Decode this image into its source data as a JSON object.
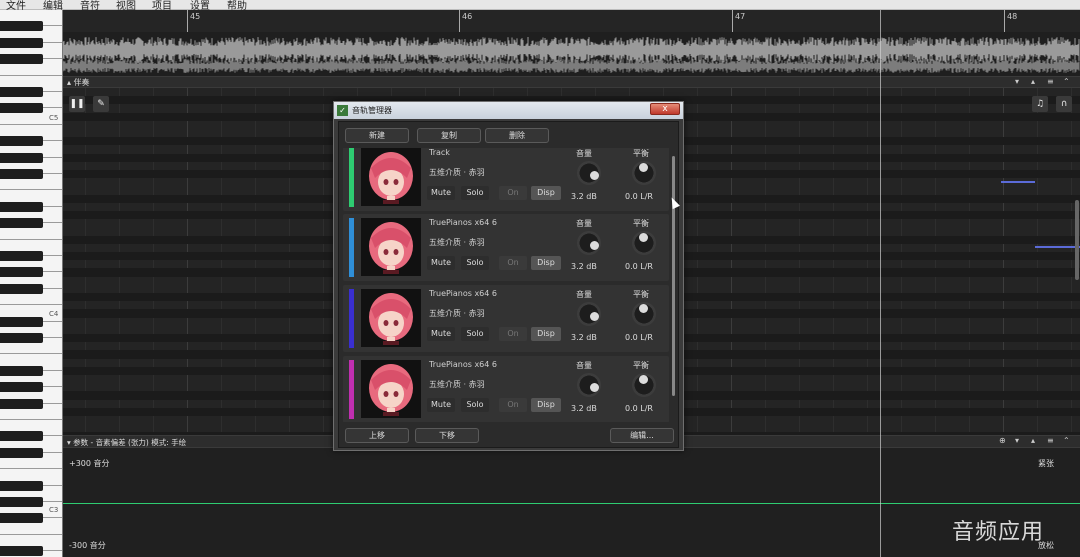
{
  "menu": [
    "文件",
    "编辑",
    "音符",
    "视图",
    "项目",
    "设置",
    "帮助"
  ],
  "ruler": {
    "bars": [
      "45",
      "46",
      "47",
      "48"
    ]
  },
  "piano": {
    "octave_labels": [
      "C5",
      "C4",
      "C3"
    ]
  },
  "accompaniment": {
    "title": "伴奏",
    "header_controls": [
      "▾",
      "▴",
      "≡",
      "⌃"
    ]
  },
  "toolbar": {
    "pause_icon": "pause-icon",
    "pencil_icon": "pencil-icon",
    "note_icon": "music-note-icon",
    "headphone_icon": "headphone-icon"
  },
  "params": {
    "header": "▾ 参数 - 音素偏差 (张力) 模式: 手绘",
    "top_label": "+300 音分",
    "bottom_label": "-300 音分",
    "right_top": "紧张",
    "right_bottom": "放松",
    "header_controls": [
      "⊕",
      "▾",
      "▴",
      "≡",
      "⌃"
    ]
  },
  "watermark": "音频应用",
  "dialog": {
    "title": "音轨管理器",
    "close": "x",
    "buttons": {
      "new": "新建",
      "copy": "复制",
      "delete": "删除",
      "up": "上移",
      "down": "下移",
      "edit": "编辑..."
    },
    "tracks": [
      {
        "name": "Track",
        "singer": "五维介质 · 赤羽",
        "color": "#2ecc71",
        "mute": "Mute",
        "solo": "Solo",
        "on": "On",
        "disp": "Disp",
        "volume_label": "音量",
        "volume": "3.2 dB",
        "pan_label": "平衡",
        "pan": "0.0 L/R"
      },
      {
        "name": "TruePianos x64 6",
        "singer": "五维介质 · 赤羽",
        "color": "#2f8fd8",
        "mute": "Mute",
        "solo": "Solo",
        "on": "On",
        "disp": "Disp",
        "volume_label": "音量",
        "volume": "3.2 dB",
        "pan_label": "平衡",
        "pan": "0.0 L/R"
      },
      {
        "name": "TruePianos x64 6",
        "singer": "五维介质 · 赤羽",
        "color": "#3a2fd0",
        "mute": "Mute",
        "solo": "Solo",
        "on": "On",
        "disp": "Disp",
        "volume_label": "音量",
        "volume": "3.2 dB",
        "pan_label": "平衡",
        "pan": "0.0 L/R"
      },
      {
        "name": "TruePianos x64 6",
        "singer": "五维介质 · 赤羽",
        "color": "#c02fb0",
        "mute": "Mute",
        "solo": "Solo",
        "on": "On",
        "disp": "Disp",
        "volume_label": "音量",
        "volume": "3.2 dB",
        "pan_label": "平衡",
        "pan": "0.0 L/R"
      }
    ]
  }
}
